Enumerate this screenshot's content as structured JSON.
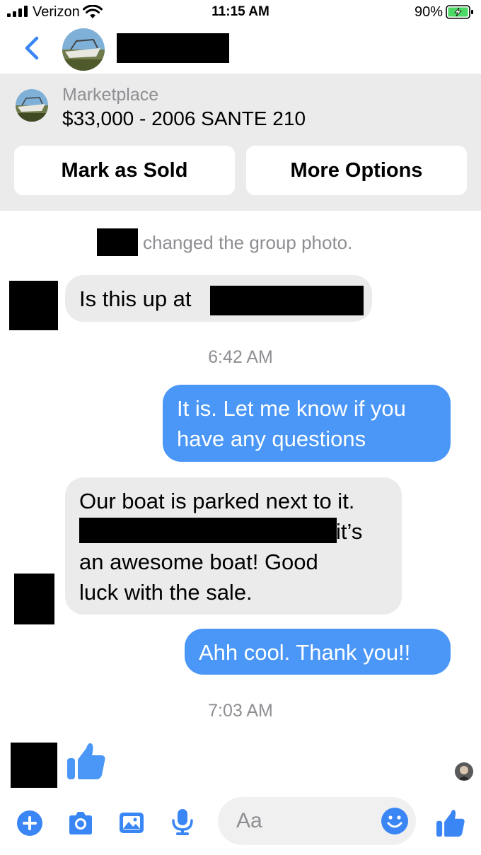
{
  "status_bar": {
    "carrier": "Verizon",
    "time": "11:15 AM",
    "battery": "90%"
  },
  "header": {
    "back_icon": "chevron-left-icon"
  },
  "marketplace": {
    "label": "Marketplace",
    "title": "$33,000 - 2006 SANTE 210",
    "mark_sold": "Mark as Sold",
    "more_options": "More Options"
  },
  "conversation": {
    "system_message": "changed the group photo.",
    "msg1": "Is this up at",
    "time1": "6:42 AM",
    "msg2_line1": "It is. Let me know if you",
    "msg2_line2": "have any questions",
    "msg3_line1": "Our boat is parked next to it.",
    "msg3_line2_end": "it’s",
    "msg3_line3": "an awesome boat! Good",
    "msg3_line4": "luck with the sale.",
    "msg4": "Ahh cool. Thank you!!",
    "time2": "7:03 AM",
    "reaction": "thumbs-up-icon"
  },
  "composer": {
    "placeholder": "Aa"
  },
  "colors": {
    "accent": "#4a97f7",
    "incoming_bubble": "#ebebeb",
    "banner": "#ebebeb",
    "meta_text": "#8e8e93"
  }
}
